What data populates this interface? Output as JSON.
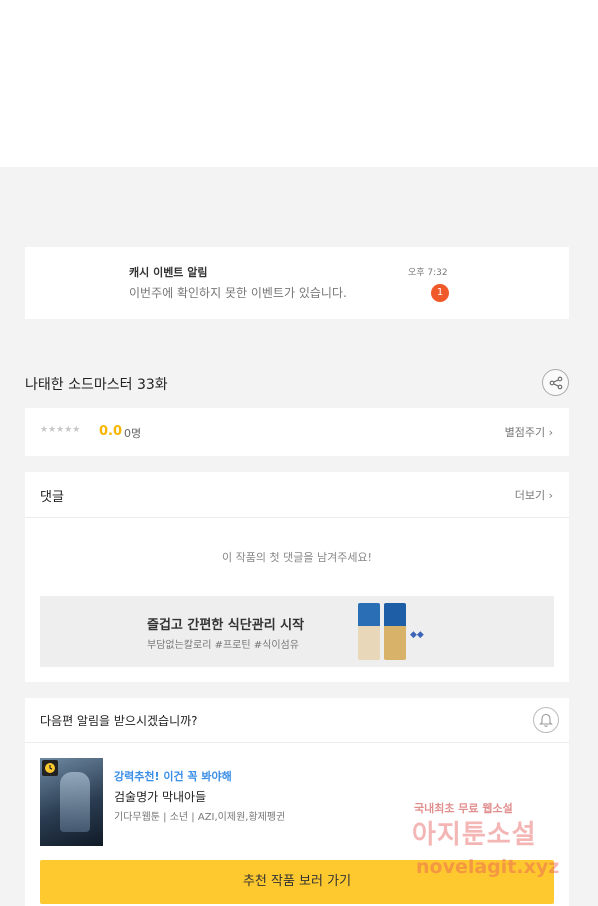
{
  "notification": {
    "title": "캐시 이벤트 알림",
    "body": "이번주에 확인하지 못한 이벤트가 있습니다.",
    "time": "오후 7:32",
    "badge": "1"
  },
  "episode": {
    "title": "나태한 소드마스터 33화"
  },
  "rating": {
    "stars": "★★★★★",
    "score": "0.0",
    "count": "0명",
    "rate_link": "별점주기 ›"
  },
  "comments": {
    "header": "댓글",
    "more": "더보기 ›",
    "empty": "이 작품의 첫 댓글을 남겨주세요!"
  },
  "ad": {
    "title": "즐겁고 간편한 식단관리 시작",
    "subtitle": "부담없는칼로리 #프로틴 #식이섬유"
  },
  "next_alert": {
    "question": "다음편 알림을 받으시겠습니까?"
  },
  "recommendation": {
    "tag": "강력추천! 이건 꼭 봐야해",
    "title": "검술명가 막내아들",
    "meta": "기다무웹툰 | 소년 | AZI,이제원,황제펭귄",
    "cta": "추천 작품 보러 가기"
  },
  "watermark": {
    "line1": "국내최초 무료 웹소설",
    "line2": "아지툰소설",
    "line3": "novelagit.xyz"
  }
}
